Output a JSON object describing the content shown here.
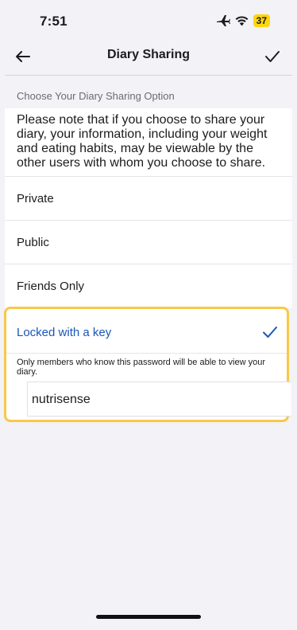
{
  "status": {
    "time": "7:51",
    "battery": "37",
    "icons": [
      "airplane-icon",
      "wifi-icon",
      "battery-icon"
    ]
  },
  "nav": {
    "title": "Diary Sharing",
    "back_icon": "arrow-left-icon",
    "done_icon": "checkmark-icon"
  },
  "section": {
    "header": "Choose Your Diary Sharing Option"
  },
  "note": "Please note that if you choose to share your diary, your information, including your weight and eating habits, may be viewable by the other users with whom you choose to share.",
  "options": [
    {
      "label": "Private",
      "selected": false
    },
    {
      "label": "Public",
      "selected": false
    },
    {
      "label": "Friends Only",
      "selected": false
    },
    {
      "label": "Locked with a key",
      "selected": true
    }
  ],
  "locked": {
    "hint": "Only members who know this password will be able to view your diary.",
    "password_value": "nutrisense"
  },
  "colors": {
    "accent": "#1a56b8",
    "highlight": "#f7c948",
    "battery": "#ffd60a"
  }
}
